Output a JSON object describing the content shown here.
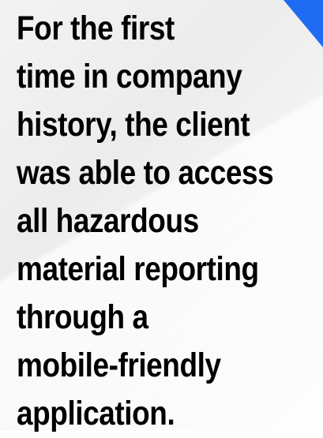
{
  "statement_lines": [
    "For the first",
    "time in company",
    "history, the client",
    "was able to access",
    "all hazardous",
    "material reporting",
    "through a",
    "mobile-friendly",
    "application."
  ],
  "colors": {
    "text": "#000000",
    "accent": "#1f6bf2",
    "background": "#f2f2f2"
  }
}
